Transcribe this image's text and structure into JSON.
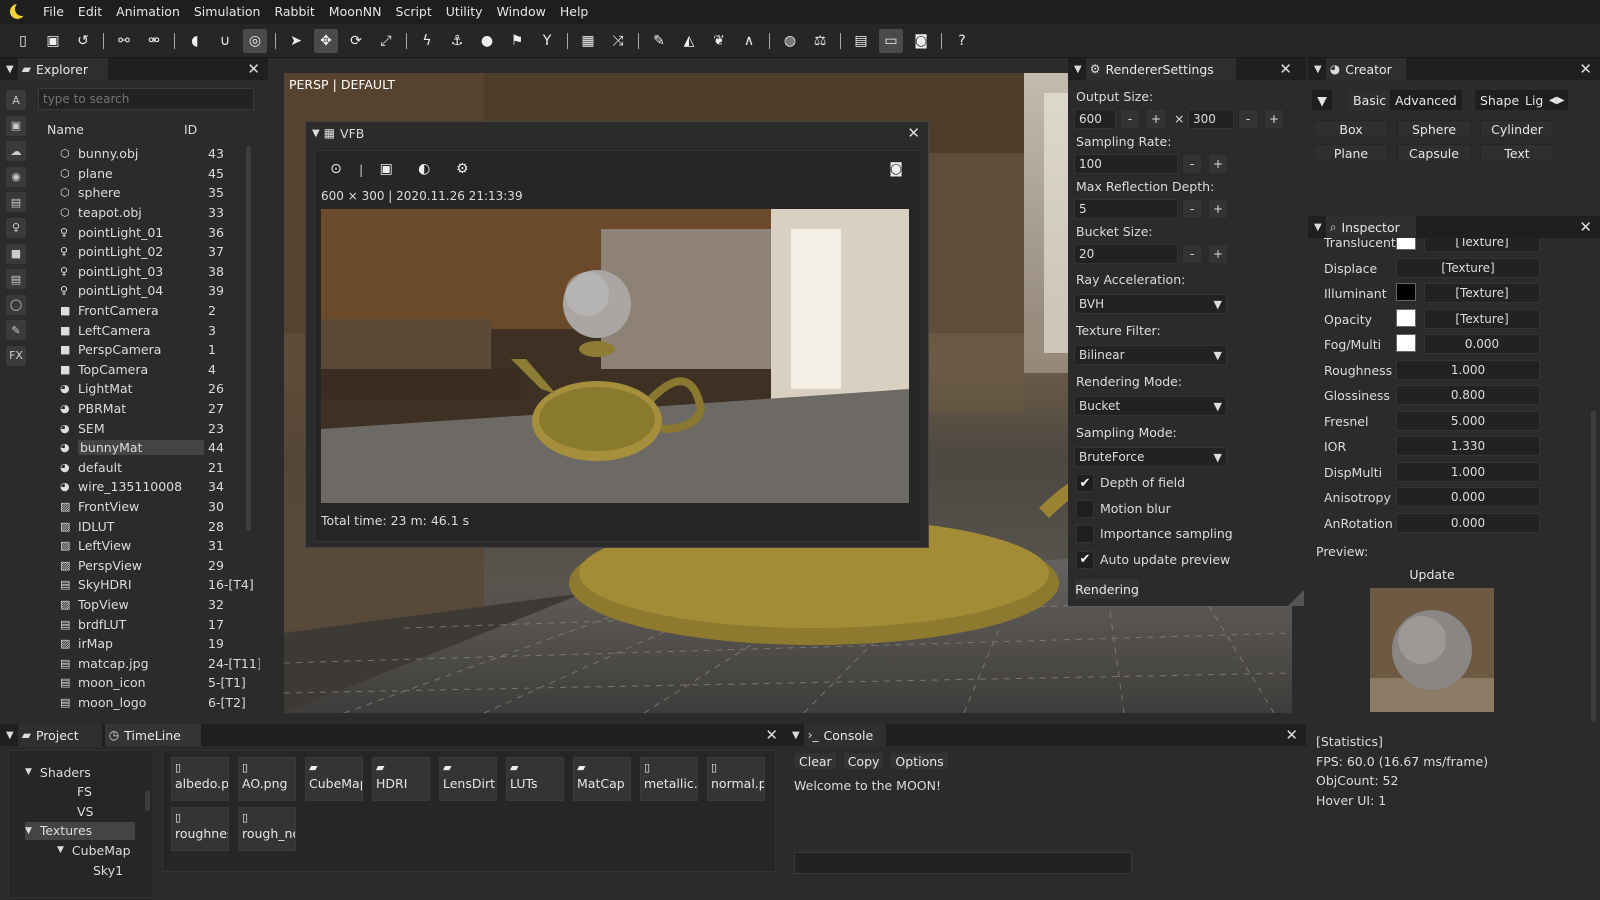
{
  "menubar": {
    "items": [
      "File",
      "Edit",
      "Animation",
      "Simulation",
      "Rabbit",
      "MoonNN",
      "Script",
      "Utility",
      "Window",
      "Help"
    ]
  },
  "toolbar": {
    "icons": [
      "new-file-icon",
      "save-icon",
      "undo-icon",
      "link-icon",
      "unlink-icon",
      "toggle-icon",
      "magnet-icon",
      "target-icon",
      "select-icon",
      "move-icon",
      "rotate-icon",
      "scale-icon",
      "lightning-icon",
      "anchor-icon",
      "drop-icon",
      "flag-icon",
      "filter-icon",
      "grid-icon",
      "shuffle-icon",
      "brush-icon",
      "terrain-icon",
      "leaf-icon",
      "road-icon",
      "globe-icon",
      "weight-icon",
      "panel-icon",
      "window-icon",
      "camera-icon",
      "help-icon"
    ]
  },
  "explorer": {
    "title": "Explorer",
    "search_placeholder": "type to search",
    "col_name": "Name",
    "col_id": "ID",
    "side_icons": [
      "A",
      "▣",
      "☁",
      "◉",
      "▤",
      "♀",
      "■",
      "▤",
      "◯",
      "✎",
      "FX"
    ],
    "rows": [
      {
        "name": "bunny.obj",
        "id": "43",
        "icon": "mesh-icon"
      },
      {
        "name": "plane",
        "id": "45",
        "icon": "mesh-icon"
      },
      {
        "name": "sphere",
        "id": "35",
        "icon": "mesh-icon"
      },
      {
        "name": "teapot.obj",
        "id": "33",
        "icon": "mesh-icon"
      },
      {
        "name": "pointLight_01",
        "id": "36",
        "icon": "light-icon"
      },
      {
        "name": "pointLight_02",
        "id": "37",
        "icon": "light-icon"
      },
      {
        "name": "pointLight_03",
        "id": "38",
        "icon": "light-icon"
      },
      {
        "name": "pointLight_04",
        "id": "39",
        "icon": "light-icon"
      },
      {
        "name": "FrontCamera",
        "id": "2",
        "icon": "camera-icon"
      },
      {
        "name": "LeftCamera",
        "id": "3",
        "icon": "camera-icon"
      },
      {
        "name": "PerspCamera",
        "id": "1",
        "icon": "camera-icon"
      },
      {
        "name": "TopCamera",
        "id": "4",
        "icon": "camera-icon"
      },
      {
        "name": "LightMat",
        "id": "26",
        "icon": "material-icon"
      },
      {
        "name": "PBRMat",
        "id": "27",
        "icon": "material-icon"
      },
      {
        "name": "SEM",
        "id": "23",
        "icon": "material-icon"
      },
      {
        "name": "bunnyMat",
        "id": "44",
        "icon": "material-icon"
      },
      {
        "name": "default",
        "id": "21",
        "icon": "material-icon"
      },
      {
        "name": "wire_135110008",
        "id": "34",
        "icon": "material-icon"
      },
      {
        "name": "FrontView",
        "id": "30",
        "icon": "image-icon"
      },
      {
        "name": "IDLUT",
        "id": "28",
        "icon": "image-icon"
      },
      {
        "name": "LeftView",
        "id": "31",
        "icon": "image-icon"
      },
      {
        "name": "PerspView",
        "id": "29",
        "icon": "image-icon"
      },
      {
        "name": "SkyHDRI",
        "id": "16-[T4]",
        "icon": "file-icon"
      },
      {
        "name": "TopView",
        "id": "32",
        "icon": "image-icon"
      },
      {
        "name": "brdfLUT",
        "id": "17",
        "icon": "file-icon"
      },
      {
        "name": "irMap",
        "id": "19",
        "icon": "image-icon"
      },
      {
        "name": "matcap.jpg",
        "id": "24-[T11]",
        "icon": "file-icon"
      },
      {
        "name": "moon_icon",
        "id": "5-[T1]",
        "icon": "file-icon"
      },
      {
        "name": "moon_logo",
        "id": "6-[T2]",
        "icon": "file-icon"
      }
    ]
  },
  "viewport": {
    "mode": "PERSP",
    "sep": "|",
    "shading": "DEFAULT"
  },
  "vfb": {
    "title": "VFB",
    "info": "600 × 300 | 2020.11.26 21:13:39",
    "total_time": "Total time: 23 m: 46.1 s"
  },
  "renderer": {
    "title": "RendererSettings",
    "output_size_label": "Output Size:",
    "width": "600",
    "height": "300",
    "times": "×",
    "sampling_rate_label": "Sampling Rate:",
    "sampling_rate": "100",
    "max_reflection_label": "Max Reflection Depth:",
    "max_reflection": "5",
    "bucket_size_label": "Bucket Size:",
    "bucket_size": "20",
    "ray_accel_label": "Ray Acceleration:",
    "ray_accel": "BVH",
    "texture_filter_label": "Texture Filter:",
    "texture_filter": "Bilinear",
    "rendering_mode_label": "Rendering Mode:",
    "rendering_mode": "Bucket",
    "sampling_mode_label": "Sampling Mode:",
    "sampling_mode": "BruteForce",
    "minus": "-",
    "plus": "+",
    "checks": [
      {
        "label": "Depth of field",
        "checked": true
      },
      {
        "label": "Motion blur",
        "checked": false
      },
      {
        "label": "Importance sampling",
        "checked": false
      },
      {
        "label": "Auto update preview",
        "checked": true
      }
    ],
    "render_button": "Rendering"
  },
  "creator": {
    "title": "Creator",
    "tabs": [
      "Basic",
      "Advanced",
      "Shape",
      "Light"
    ],
    "shapes": [
      "Box",
      "Sphere",
      "Cylinder",
      "Plane",
      "Capsule",
      "Text"
    ]
  },
  "inspector": {
    "title": "Inspector",
    "rows": [
      {
        "label": "Translucent",
        "swatch": "#ffffff",
        "value": "[Texture]",
        "kind": "tex"
      },
      {
        "label": "Displace",
        "value": "[Texture]",
        "kind": "val"
      },
      {
        "label": "Illuminant",
        "swatch": "#000000",
        "value": "[Texture]",
        "kind": "tex"
      },
      {
        "label": "Opacity",
        "swatch": "#ffffff",
        "value": "[Texture]",
        "kind": "tex"
      },
      {
        "label": "Fog/Multi",
        "swatch": "#ffffff",
        "value": "0.000",
        "kind": "tex"
      },
      {
        "label": "Roughness",
        "value": "1.000",
        "kind": "val"
      },
      {
        "label": "Glossiness",
        "value": "0.800",
        "kind": "val"
      },
      {
        "label": "Fresnel",
        "value": "5.000",
        "kind": "val"
      },
      {
        "label": "IOR",
        "value": "1.330",
        "kind": "val"
      },
      {
        "label": "DispMulti",
        "value": "1.000",
        "kind": "val"
      },
      {
        "label": "Anisotropy",
        "value": "0.000",
        "kind": "val"
      },
      {
        "label": "AnRotation",
        "value": "0.000",
        "kind": "val"
      }
    ],
    "preview_label": "Preview:",
    "update_button": "Update"
  },
  "project": {
    "tab_project": "Project",
    "tab_timeline": "TimeLine",
    "tree": [
      {
        "label": "Shaders",
        "level": 1,
        "arrow": "▼"
      },
      {
        "label": "FS",
        "level": 2,
        "arrow": ""
      },
      {
        "label": "VS",
        "level": 2,
        "arrow": ""
      },
      {
        "label": "Textures",
        "level": 1,
        "arrow": "▼",
        "selected": true
      },
      {
        "label": "CubeMap",
        "level": 2,
        "arrow": "▼"
      },
      {
        "label": "Sky1",
        "level": 3,
        "arrow": ""
      }
    ],
    "assets": [
      {
        "name": "albedo.pr",
        "type": "file"
      },
      {
        "name": "AO.png",
        "type": "file"
      },
      {
        "name": "CubeMap",
        "type": "folder"
      },
      {
        "name": "HDRI",
        "type": "folder"
      },
      {
        "name": "LensDirt",
        "type": "folder"
      },
      {
        "name": "LUTs",
        "type": "folder"
      },
      {
        "name": "MatCap",
        "type": "folder"
      },
      {
        "name": "metallic.p",
        "type": "file"
      },
      {
        "name": "normal.pr",
        "type": "file"
      },
      {
        "name": "roughnes",
        "type": "file"
      },
      {
        "name": "rough_no",
        "type": "file"
      }
    ]
  },
  "console": {
    "title": "Console",
    "buttons": [
      "Clear",
      "Copy",
      "Options"
    ],
    "log": "Welcome to the MOON!"
  },
  "stats": {
    "lines": [
      "[Statistics]",
      "FPS: 60.0 (16.67 ms/frame)",
      "ObjCount: 52",
      "Hover UI: 1"
    ]
  }
}
